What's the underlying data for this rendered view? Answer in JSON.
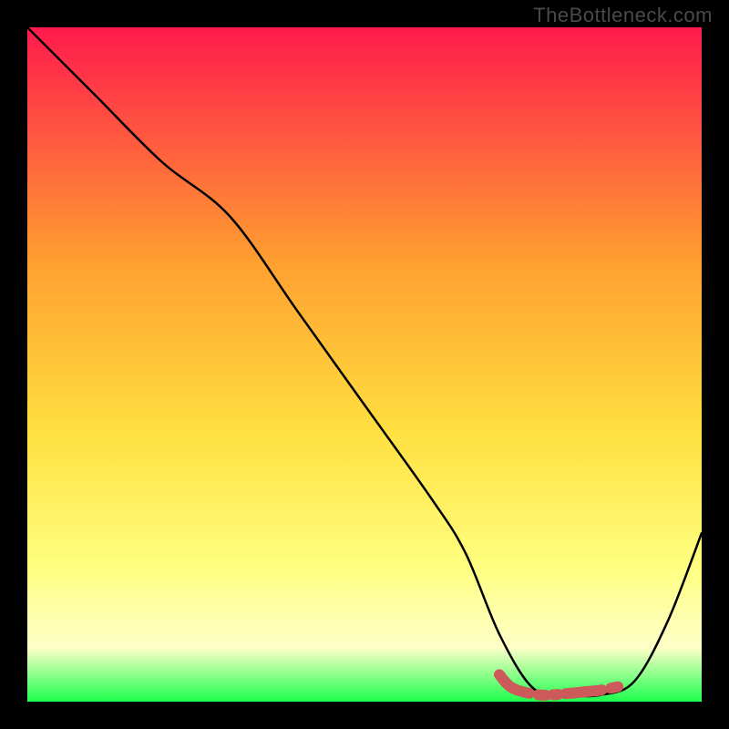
{
  "watermark": "TheBottleneck.com",
  "chart_data": {
    "type": "line",
    "title": "",
    "xlabel": "",
    "ylabel": "",
    "xlim": [
      0,
      100
    ],
    "ylim": [
      0,
      100
    ],
    "curve": {
      "x": [
        0,
        10,
        20,
        30,
        40,
        50,
        60,
        65,
        70,
        75,
        80,
        85,
        90,
        95,
        100
      ],
      "y": [
        100,
        90,
        80,
        72,
        58,
        44,
        30,
        22,
        10,
        2,
        1,
        1,
        3,
        12,
        25
      ]
    },
    "optimal_segment": {
      "x": [
        70,
        72,
        76,
        80,
        83,
        85,
        88
      ],
      "y": [
        4,
        2,
        1,
        1.2,
        1.5,
        1.7,
        2.3
      ]
    },
    "gradient_top": "#ff1a4d",
    "gradient_mid1": "#ffa030",
    "gradient_mid2": "#ffe040",
    "gradient_mid3": "#ffff80",
    "gradient_mid4": "#fdffc8",
    "gradient_bot": "#1cff4d",
    "accent_color": "#cc5a5a"
  }
}
